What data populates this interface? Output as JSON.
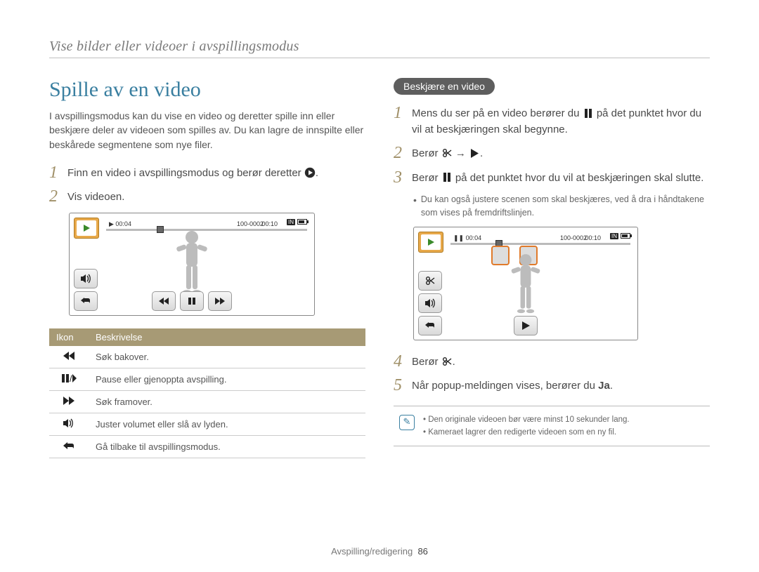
{
  "breadcrumb": "Vise bilder eller videoer i avspillingsmodus",
  "left": {
    "title": "Spille av en video",
    "intro": "I avspillingsmodus kan du vise en video og deretter spille inn eller beskjære deler av videoen som spilles av. Du kan lagre de innspilte eller beskårede segmentene som nye filer.",
    "step1": "Finn en video i avspillingsmodus og berør deretter",
    "step1_suffix": ".",
    "step2": "Vis videoen.",
    "fig": {
      "elapsed": "00:04",
      "total": "00:10",
      "file": "100-0002",
      "in": "IN"
    },
    "table": {
      "h1": "Ikon",
      "h2": "Beskrivelse",
      "r1": "Søk bakover.",
      "r2": "Pause eller gjenoppta avspilling.",
      "r3": "Søk framover.",
      "r4": "Juster volumet eller slå av lyden.",
      "r5": "Gå tilbake til avspillingsmodus."
    }
  },
  "right": {
    "pill": "Beskjære en video",
    "step1a": "Mens du ser på en video berører du",
    "step1b": "på det punktet hvor du vil at beskjæringen skal begynne.",
    "step2a": "Berør",
    "step2_arrow": "→",
    "step2_suffix": ".",
    "step3a": "Berør",
    "step3b": "på det punktet hvor du vil at beskjæringen skal slutte.",
    "sub": "Du kan også justere scenen som skal beskjæres, ved å dra i håndtakene som vises på fremdriftslinjen.",
    "fig": {
      "elapsed": "00:04",
      "total": "00:10",
      "file": "100-0002",
      "in": "IN"
    },
    "step4a": "Berør",
    "step4_suffix": ".",
    "step5a": "Når popup-meldingen vises, berører du ",
    "step5_bold": "Ja",
    "step5_suffix": ".",
    "note1": "Den originale videoen bør være minst 10 sekunder lang.",
    "note2": "Kameraet lagrer den redigerte videoen som en ny fil."
  },
  "footer": {
    "section": "Avspilling/redigering",
    "page": "86"
  }
}
